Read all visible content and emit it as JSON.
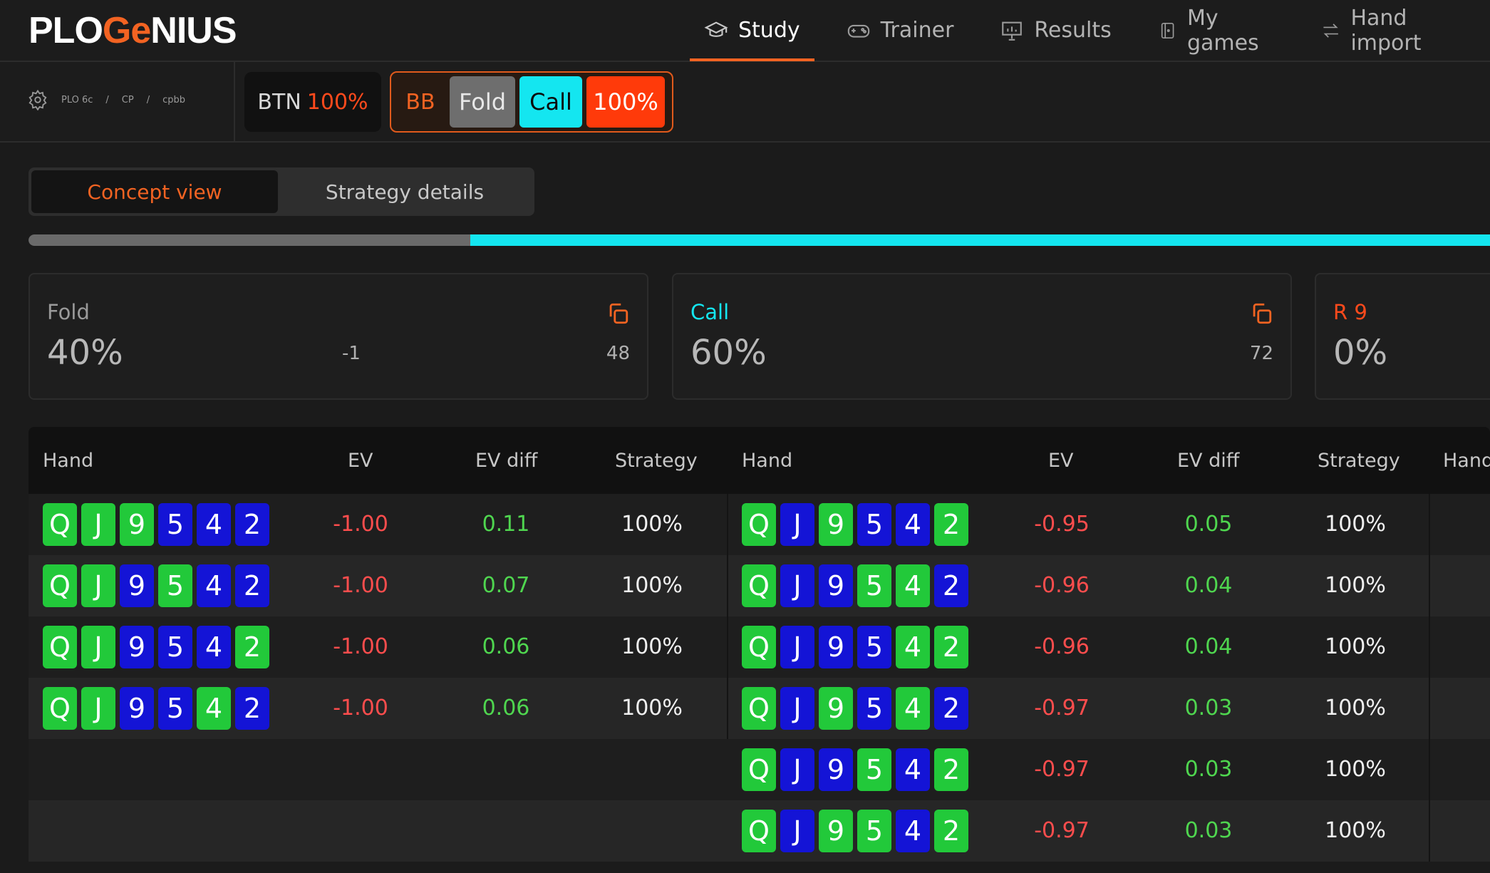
{
  "logo": {
    "part1": "PLO ",
    "mark": "Ge",
    "part2": "NIUS"
  },
  "nav": [
    {
      "label": "Study",
      "icon": "graduation-cap-icon",
      "active": true
    },
    {
      "label": "Trainer",
      "icon": "gamepad-icon",
      "active": false
    },
    {
      "label": "Results",
      "icon": "presentation-chart-icon",
      "active": false
    },
    {
      "label": "My games",
      "icon": "card-deck-icon",
      "active": false
    },
    {
      "label": "Hand import",
      "icon": "transfer-arrows-icon",
      "active": false
    }
  ],
  "breadcrumb": {
    "icon": "gear-icon",
    "items": [
      "PLO 6c",
      "CP",
      "cpbb"
    ],
    "separator": "/"
  },
  "btn_chip": {
    "position": "BTN",
    "pct": "100%"
  },
  "bb_chip": {
    "position": "BB",
    "fold": "Fold",
    "call": "Call",
    "raise": "100%"
  },
  "tabs": {
    "concept": "Concept view",
    "details": "Strategy details"
  },
  "strategy_bar": {
    "fold_fraction": 0.4,
    "call_fraction": 0.6
  },
  "cards": {
    "fold": {
      "name": "Fold",
      "pct": "40%",
      "mid": "-1",
      "count": "48",
      "color": "#9a9a9a"
    },
    "call": {
      "name": "Call",
      "pct": "60%",
      "count": "72",
      "color": "#14e6f0"
    },
    "raise": {
      "name": "R 9",
      "pct": "0%",
      "color": "#ff4a1c"
    }
  },
  "table": {
    "headers": {
      "hand": "Hand",
      "ev": "EV",
      "ev_diff": "EV diff",
      "strategy": "Strategy",
      "hand_cut": "Hand"
    },
    "left_rows": [
      {
        "ranks": [
          "Q",
          "J",
          "9",
          "5",
          "4",
          "2"
        ],
        "suits": [
          "g",
          "g",
          "g",
          "b",
          "b",
          "b"
        ],
        "ev": "-1.00",
        "ev_diff": "0.11",
        "strategy": "100%"
      },
      {
        "ranks": [
          "Q",
          "J",
          "9",
          "5",
          "4",
          "2"
        ],
        "suits": [
          "g",
          "g",
          "b",
          "g",
          "b",
          "b"
        ],
        "ev": "-1.00",
        "ev_diff": "0.07",
        "strategy": "100%"
      },
      {
        "ranks": [
          "Q",
          "J",
          "9",
          "5",
          "4",
          "2"
        ],
        "suits": [
          "g",
          "g",
          "b",
          "b",
          "b",
          "g"
        ],
        "ev": "-1.00",
        "ev_diff": "0.06",
        "strategy": "100%"
      },
      {
        "ranks": [
          "Q",
          "J",
          "9",
          "5",
          "4",
          "2"
        ],
        "suits": [
          "g",
          "g",
          "b",
          "b",
          "g",
          "b"
        ],
        "ev": "-1.00",
        "ev_diff": "0.06",
        "strategy": "100%"
      }
    ],
    "right_rows": [
      {
        "ranks": [
          "Q",
          "J",
          "9",
          "5",
          "4",
          "2"
        ],
        "suits": [
          "g",
          "b",
          "g",
          "b",
          "b",
          "g"
        ],
        "ev": "-0.95",
        "ev_diff": "0.05",
        "strategy": "100%"
      },
      {
        "ranks": [
          "Q",
          "J",
          "9",
          "5",
          "4",
          "2"
        ],
        "suits": [
          "g",
          "b",
          "b",
          "g",
          "g",
          "b"
        ],
        "ev": "-0.96",
        "ev_diff": "0.04",
        "strategy": "100%"
      },
      {
        "ranks": [
          "Q",
          "J",
          "9",
          "5",
          "4",
          "2"
        ],
        "suits": [
          "g",
          "b",
          "b",
          "b",
          "g",
          "g"
        ],
        "ev": "-0.96",
        "ev_diff": "0.04",
        "strategy": "100%"
      },
      {
        "ranks": [
          "Q",
          "J",
          "9",
          "5",
          "4",
          "2"
        ],
        "suits": [
          "g",
          "b",
          "g",
          "b",
          "g",
          "b"
        ],
        "ev": "-0.97",
        "ev_diff": "0.03",
        "strategy": "100%"
      },
      {
        "ranks": [
          "Q",
          "J",
          "9",
          "5",
          "4",
          "2"
        ],
        "suits": [
          "g",
          "b",
          "b",
          "g",
          "b",
          "g"
        ],
        "ev": "-0.97",
        "ev_diff": "0.03",
        "strategy": "100%"
      },
      {
        "ranks": [
          "Q",
          "J",
          "9",
          "5",
          "4",
          "2"
        ],
        "suits": [
          "g",
          "b",
          "g",
          "g",
          "b",
          "g"
        ],
        "ev": "-0.97",
        "ev_diff": "0.03",
        "strategy": "100%"
      }
    ]
  },
  "colors": {
    "accent": "#f26322",
    "call": "#14e6f0",
    "raise": "#ff3a0a",
    "ev_negative": "#ff4d4d",
    "ev_diff": "#4fd64f",
    "suit_green": "#22c93a",
    "suit_blue": "#1414d6"
  }
}
